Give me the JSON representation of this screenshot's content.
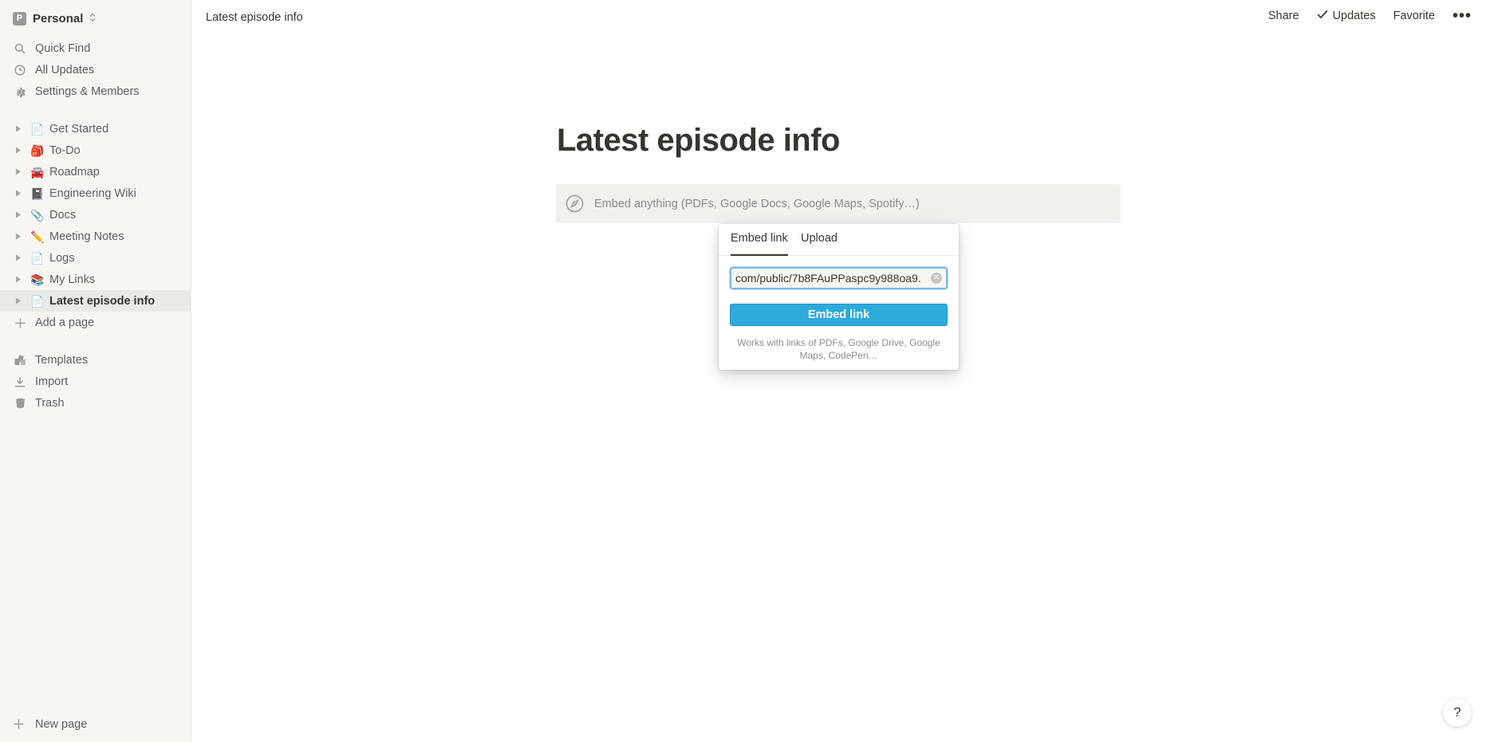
{
  "workspace": {
    "initial": "P",
    "name": "Personal"
  },
  "sidebar": {
    "top_items": [
      {
        "label": "Quick Find",
        "icon": "search-icon"
      },
      {
        "label": "All Updates",
        "icon": "clock-icon"
      },
      {
        "label": "Settings & Members",
        "icon": "gear-icon"
      }
    ],
    "pages": [
      {
        "label": "Get Started",
        "emoji": "📄"
      },
      {
        "label": "To-Do",
        "emoji": "🎒"
      },
      {
        "label": "Roadmap",
        "emoji": "🚘"
      },
      {
        "label": "Engineering Wiki",
        "emoji": "📓"
      },
      {
        "label": "Docs",
        "emoji": "📎"
      },
      {
        "label": "Meeting Notes",
        "emoji": "✏️"
      },
      {
        "label": "Logs",
        "emoji": "📄"
      },
      {
        "label": "My Links",
        "emoji": "📚"
      },
      {
        "label": "Latest episode info",
        "emoji": "📄",
        "active": true
      }
    ],
    "add_page": "Add a page",
    "bottom_items": [
      {
        "label": "Templates",
        "icon": "templates-icon"
      },
      {
        "label": "Import",
        "icon": "import-icon"
      },
      {
        "label": "Trash",
        "icon": "trash-icon"
      }
    ],
    "new_page": "New page"
  },
  "topbar": {
    "breadcrumb": "Latest episode info",
    "share": "Share",
    "updates": "Updates",
    "favorite": "Favorite",
    "more": "•••"
  },
  "page": {
    "title": "Latest episode info",
    "embed_placeholder": "Embed anything (PDFs, Google Docs, Google Maps, Spotify…)"
  },
  "popover": {
    "tabs": [
      "Embed link",
      "Upload"
    ],
    "url_value": ".com/public/7b8FAuPPaspc9y988oa9",
    "button": "Embed link",
    "hint": "Works with links of PDFs, Google Drive, Google Maps, CodePen…"
  },
  "help": "?"
}
